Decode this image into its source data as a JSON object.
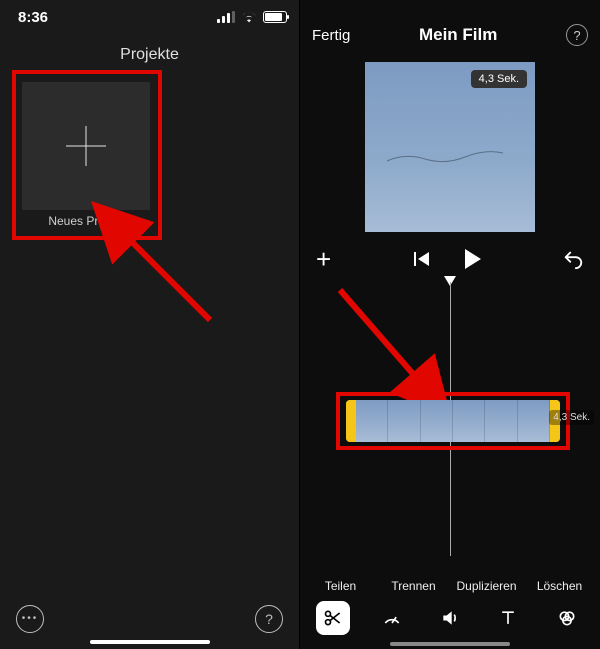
{
  "left": {
    "status_time": "8:36",
    "title": "Projekte",
    "new_project_label": "Neues Projekt"
  },
  "right": {
    "done_label": "Fertig",
    "film_title": "Mein Film",
    "preview_duration": "4,3 Sek.",
    "clip_duration": "4,3 Sek.",
    "actions": {
      "share": "Teilen",
      "split": "Trennen",
      "duplicate": "Duplizieren",
      "delete": "Löschen"
    }
  }
}
